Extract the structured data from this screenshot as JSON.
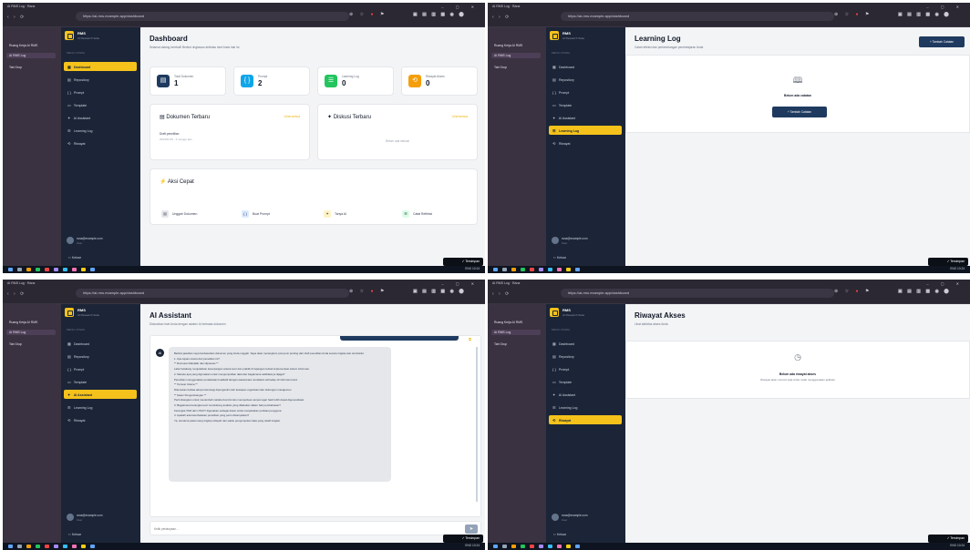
{
  "browser": {
    "window_title": "AI RMS Log · Rana",
    "url": "https://ai-rms.example.app/dashboard",
    "rail_items": [
      "Ruang Kerja AI RMS",
      "AI RMS Log",
      "Tab Grup"
    ]
  },
  "sidebar": {
    "brand": "RMS",
    "brand_sub": "AI Research Suite",
    "menu_caption": "MENU UTAMA",
    "items": [
      {
        "icon": "▦",
        "label": "Dashboard"
      },
      {
        "icon": "▤",
        "label": "Repository"
      },
      {
        "icon": "{ }",
        "label": "Prompt"
      },
      {
        "icon": "▭",
        "label": "Template"
      },
      {
        "icon": "✦",
        "label": "AI Assistant"
      },
      {
        "icon": "☰",
        "label": "Learning Log"
      },
      {
        "icon": "⟲",
        "label": "Riwayat"
      }
    ],
    "user_email": "rana@example.com",
    "user_role": "User",
    "logout": "Keluar"
  },
  "dashboard": {
    "title": "Dashboard",
    "subtitle": "Selamat datang kembali! Berikut ringkasan aktivitas riset Anda hari ini.",
    "stats": [
      {
        "label": "Total Dokumen",
        "value": "1",
        "color": "#1e3a5f",
        "icon": "▤"
      },
      {
        "label": "Prompt",
        "value": "2",
        "color": "#0ea5e9",
        "icon": "{ }"
      },
      {
        "label": "Learning Log",
        "value": "0",
        "color": "#22c55e",
        "icon": "☰"
      },
      {
        "label": "Riwayat Akses",
        "value": "0",
        "color": "#f59e0b",
        "icon": "⟲"
      }
    ],
    "recent_docs_title": "Dokumen Terbaru",
    "recent_docs_link": "Lihat semua",
    "recent_doc_name": "Draft penelitian",
    "recent_doc_meta": "2024/01/15 · 2 minggu lalu",
    "recent_prompts_title": "Diskusi Terbaru",
    "recent_prompts_link": "Lihat semua",
    "recent_prompts_empty": "Belum ada diskusi",
    "quick_title": "Aksi Cepat",
    "quick_actions": [
      {
        "label": "Unggah Dokumen",
        "icon": "▤",
        "color": "#e5e7eb"
      },
      {
        "label": "Buat Prompt",
        "icon": "{ }",
        "color": "#dbeafe"
      },
      {
        "label": "Tanya AI",
        "icon": "✦",
        "color": "#fef3c7"
      },
      {
        "label": "Catat Refleksi",
        "icon": "☰",
        "color": "#dcfce7"
      }
    ]
  },
  "learning": {
    "title": "Learning Log",
    "subtitle": "Catat refleksi dan perkembangan pembelajaran Anda",
    "new_button": "+ Tambah Catatan",
    "empty_title": "Belum ada catatan",
    "empty_button": "+ Tambah Catatan"
  },
  "assistant": {
    "title": "AI Assistant",
    "subtitle": "Diskusikan riset Anda dengan asisten AI berbasis dokumen",
    "avatar": "AI",
    "messages": [
      "Berikut jawaban saya berdasarkan dokumen yang Anda unggah. Saya akan merangkum poin-poin penting dari draft penelitian Anda secara ringkas dan terstruktur.",
      "1. Apa tujuan utama dari penelitian ini?",
      "** Rumusan Masalah dan Hipotesis **",
      "Latar belakang menjelaskan kesenjangan antara teori dan praktik di lapangan terkait implementasi sistem informasi.",
      "2. Metode apa yang digunakan untuk mengumpulkan data dan bagaimana validitasnya dijaga?",
      "Penelitian menggunakan pendekatan kualitatif dengan wawancara mendalam terhadap 12 informan kunci.",
      "** Temuan Utama **",
      "Ditemukan bahwa adopsi teknologi dipengaruhi oleh kesiapan organisasi dan dukungan manajemen.",
      "** Saran Pengembangan **",
      "Pertimbangkan untuk menambah variabel kontrol dan memperluas sampel agar hasil lebih dapat digeneralisasi.",
      "3. Bagaimana kerangka teori mendukung analisis yang dilakukan dalam bab pembahasan?",
      "Kerangka TAM dan UTAUT digunakan sebagai dasar untuk menjelaskan perilaku pengguna.",
      "4. Apakah ada keterbatasan penelitian yang perlu disampaikan?",
      "Ya, terutama pada ruang lingkup wilayah dan waktu pengumpulan data yang relatif singkat."
    ],
    "input_placeholder": "Ketik pertanyaan...",
    "send_icon": "➤"
  },
  "riwayat": {
    "title": "Riwayat Akses",
    "subtitle": "Lihat aktivitas akses Anda",
    "empty_title": "Belum ada riwayat akses",
    "empty_sub": "Riwayat akan muncul saat Anda mulai menggunakan aplikasi"
  },
  "toast": "✓ Tersimpan",
  "tray": "ENG  10:24"
}
